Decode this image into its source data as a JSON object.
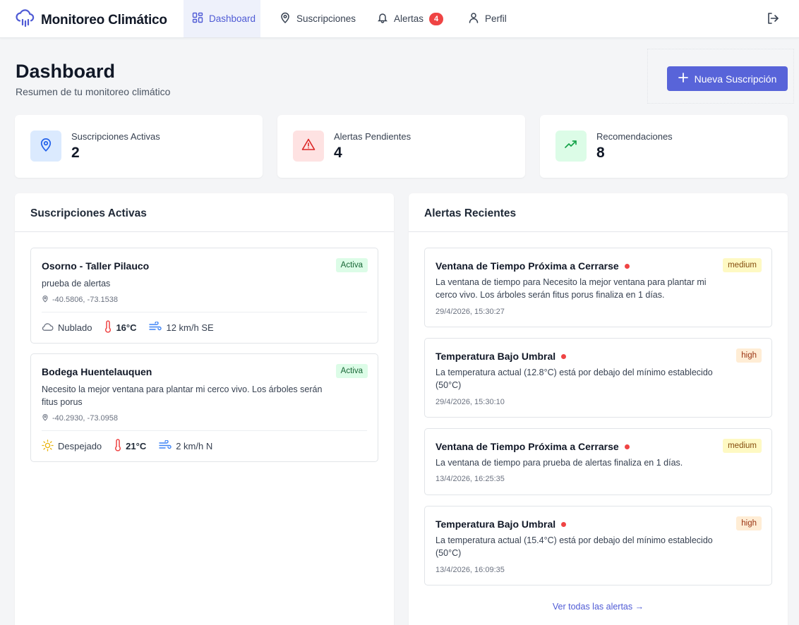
{
  "app": {
    "title": "Monitoreo Climático",
    "accent": "#5864d9"
  },
  "nav": {
    "items": [
      {
        "label": "Dashboard",
        "icon": "grid-icon",
        "active": true
      },
      {
        "label": "Suscripciones",
        "icon": "map-pin-icon",
        "active": false
      },
      {
        "label": "Alertas",
        "icon": "bell-icon",
        "active": false,
        "badge": "4"
      },
      {
        "label": "Perfil",
        "icon": "user-icon",
        "active": false
      }
    ],
    "logout_icon": "logout-icon"
  },
  "header": {
    "title": "Dashboard",
    "subtitle": "Resumen de tu monitoreo climático",
    "new_button": "Nueva Suscripción"
  },
  "stats": [
    {
      "label": "Suscripciones Activas",
      "value": "2",
      "icon": "map-pin-icon",
      "color": "#2563eb",
      "bg": "#dbeafe"
    },
    {
      "label": "Alertas Pendientes",
      "value": "4",
      "icon": "warning-icon",
      "color": "#dc2626",
      "bg": "#fee2e2"
    },
    {
      "label": "Recomendaciones",
      "value": "8",
      "icon": "trending-up-icon",
      "color": "#16a34a",
      "bg": "#dcfce7"
    }
  ],
  "subscriptions": {
    "title": "Suscripciones Activas",
    "items": [
      {
        "name": "Osorno - Taller Pilauco",
        "status": "Activa",
        "description": "prueba de alertas",
        "coords": "-40.5806, -73.1538",
        "condition": "Nublado",
        "condition_icon": "cloud-icon",
        "temperature": "16°C",
        "wind": "12 km/h SE"
      },
      {
        "name": "Bodega Huentelauquen",
        "status": "Activa",
        "description": "Necesito la mejor ventana para plantar mi cerco vivo. Los árboles serán fitus porus",
        "coords": "-40.2930, -73.0958",
        "condition": "Despejado",
        "condition_icon": "sun-icon",
        "temperature": "21°C",
        "wind": "2 km/h N"
      }
    ]
  },
  "alerts": {
    "title": "Alertas Recientes",
    "see_all": "Ver todas las alertas →",
    "items": [
      {
        "title": "Ventana de Tiempo Próxima a Cerrarse",
        "severity": "medium",
        "message": "La ventana de tiempo para Necesito la mejor ventana para plantar mi cerco vivo. Los árboles serán fitus porus finaliza en 1 días.",
        "time": "29/4/2026, 15:30:27"
      },
      {
        "title": "Temperatura Bajo Umbral",
        "severity": "high",
        "message": "La temperatura actual (12.8°C) está por debajo del mínimo establecido (50°C)",
        "time": "29/4/2026, 15:30:10"
      },
      {
        "title": "Ventana de Tiempo Próxima a Cerrarse",
        "severity": "medium",
        "message": "La ventana de tiempo para prueba de alertas finaliza en 1 días.",
        "time": "13/4/2026, 16:25:35"
      },
      {
        "title": "Temperatura Bajo Umbral",
        "severity": "high",
        "message": "La temperatura actual (15.4°C) está por debajo del mínimo establecido (50°C)",
        "time": "13/4/2026, 16:09:35"
      }
    ]
  }
}
